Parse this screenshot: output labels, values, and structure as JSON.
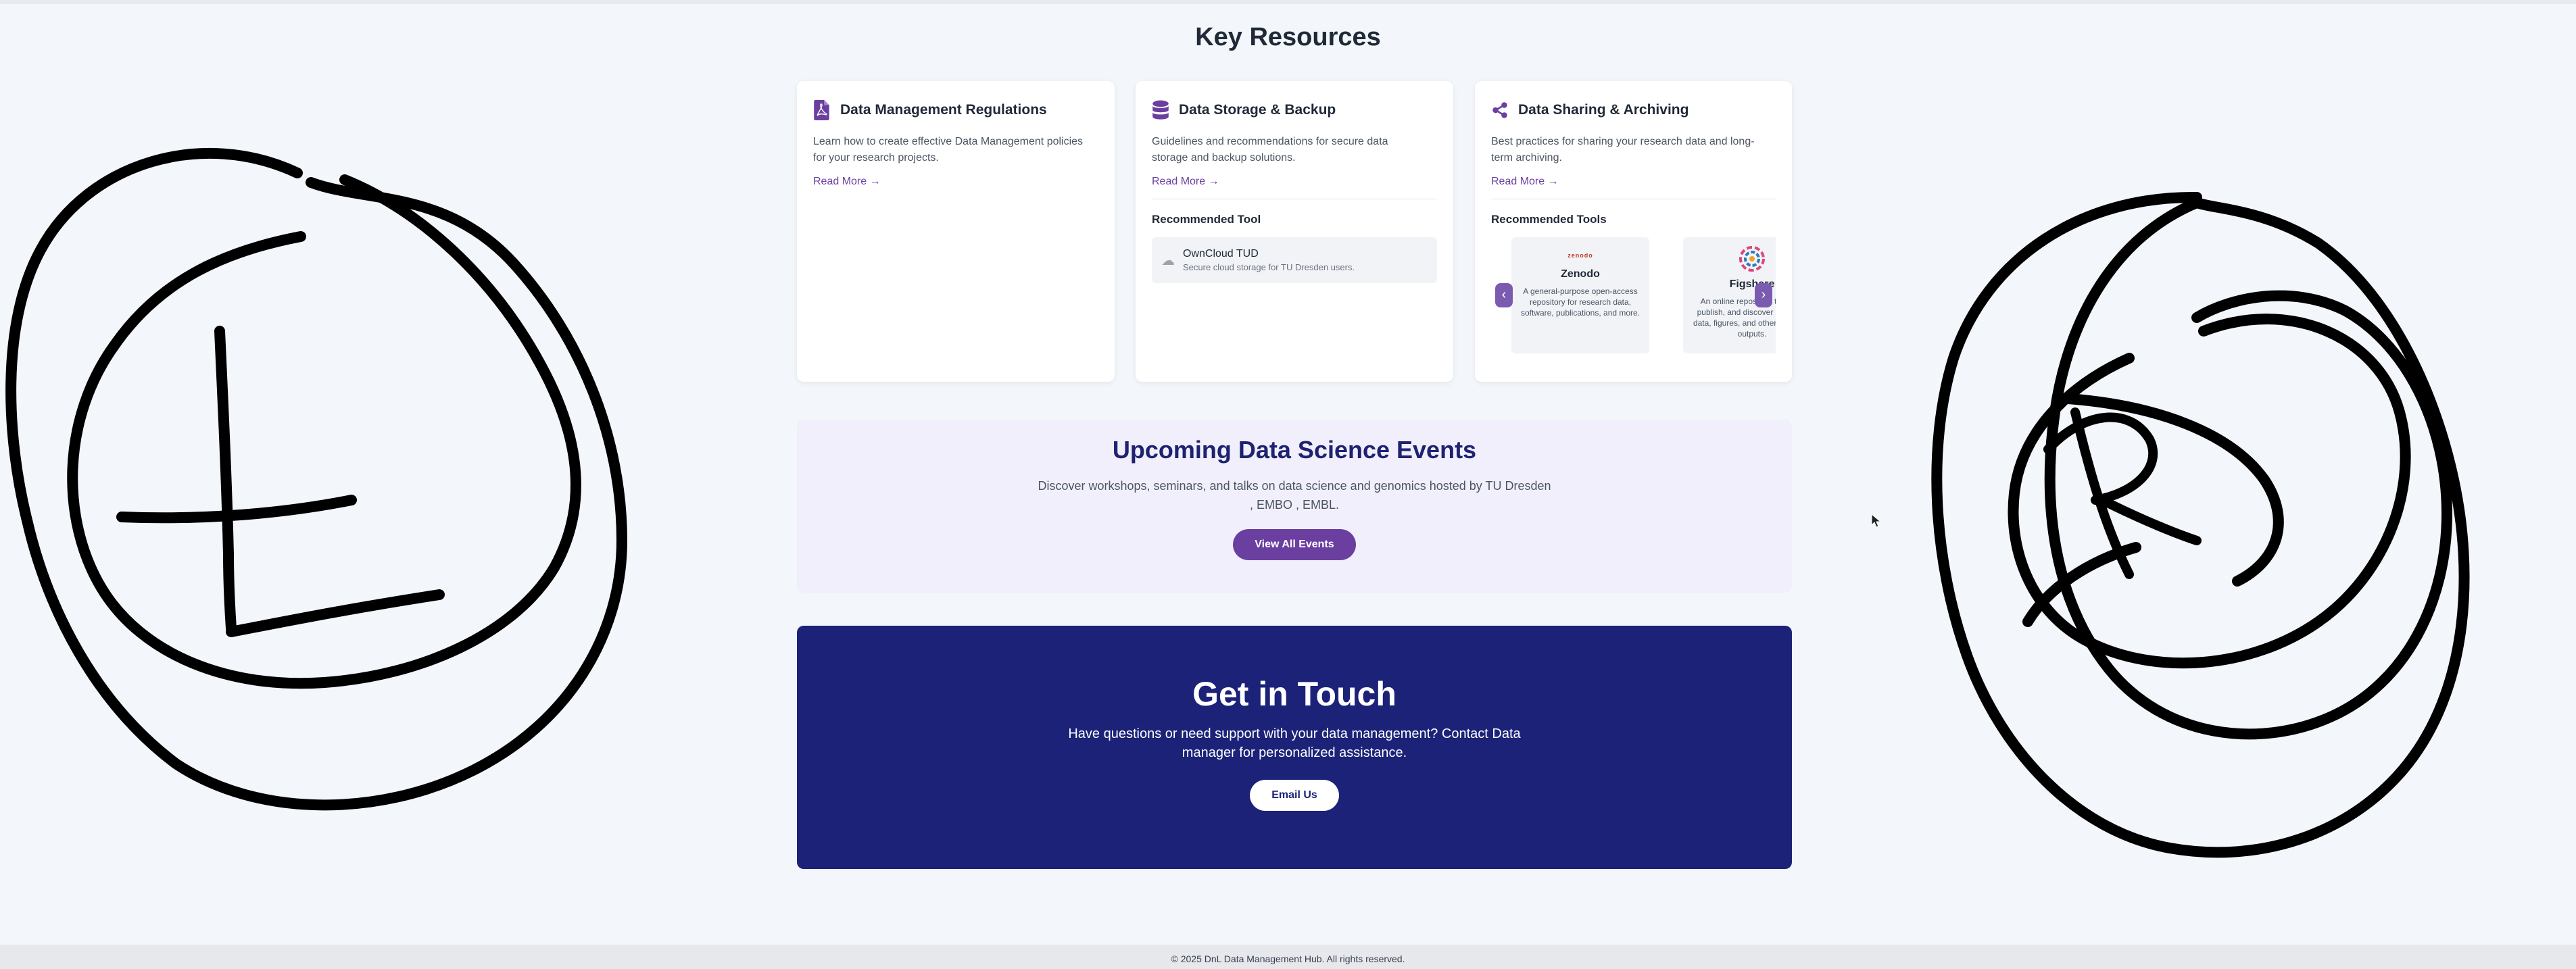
{
  "section_title": "Key Resources",
  "cards": [
    {
      "title": "Data Management Regulations",
      "icon": "document-pdf-icon",
      "description": "Learn how to create effective Data Management policies for your research projects.",
      "read_more": "Read More →"
    },
    {
      "title": "Data Storage & Backup",
      "icon": "database-icon",
      "description": "Guidelines and recommendations for secure data storage and backup solutions.",
      "read_more": "Read More →",
      "recommended_title": "Recommended Tool",
      "tool": {
        "name": "OwnCloud TUD",
        "description": "Secure cloud storage for TU Dresden users.",
        "icon": "cloud-icon"
      }
    },
    {
      "title": "Data Sharing & Archiving",
      "icon": "share-icon",
      "description": "Best practices for sharing your research data and long-term archiving.",
      "read_more": "Read More →",
      "recommended_title": "Recommended Tools",
      "tools": [
        {
          "name": "Zenodo",
          "logo_text": "zenodo",
          "description": "A general-purpose open-access repository for research data, software, publications, and more."
        },
        {
          "name": "Figshare",
          "description": "An online repository to store, publish, and discover research data, figures, and other scholarly outputs."
        }
      ]
    }
  ],
  "events": {
    "title": "Upcoming Data Science Events",
    "description": "Discover workshops, seminars, and talks on data science and genomics hosted by TU Dresden , EMBO , EMBL.",
    "button": "View All Events"
  },
  "contact": {
    "title": "Get in Touch",
    "description": "Have questions or need support with your data management? Contact Data manager for personalized assistance.",
    "button": "Email Us"
  },
  "footer": {
    "text": "© 2025 DnL Data Management Hub. All rights reserved."
  },
  "colors": {
    "accent": "#6b3fa0",
    "navy": "#1b2278",
    "background": "#f3f6fa"
  }
}
